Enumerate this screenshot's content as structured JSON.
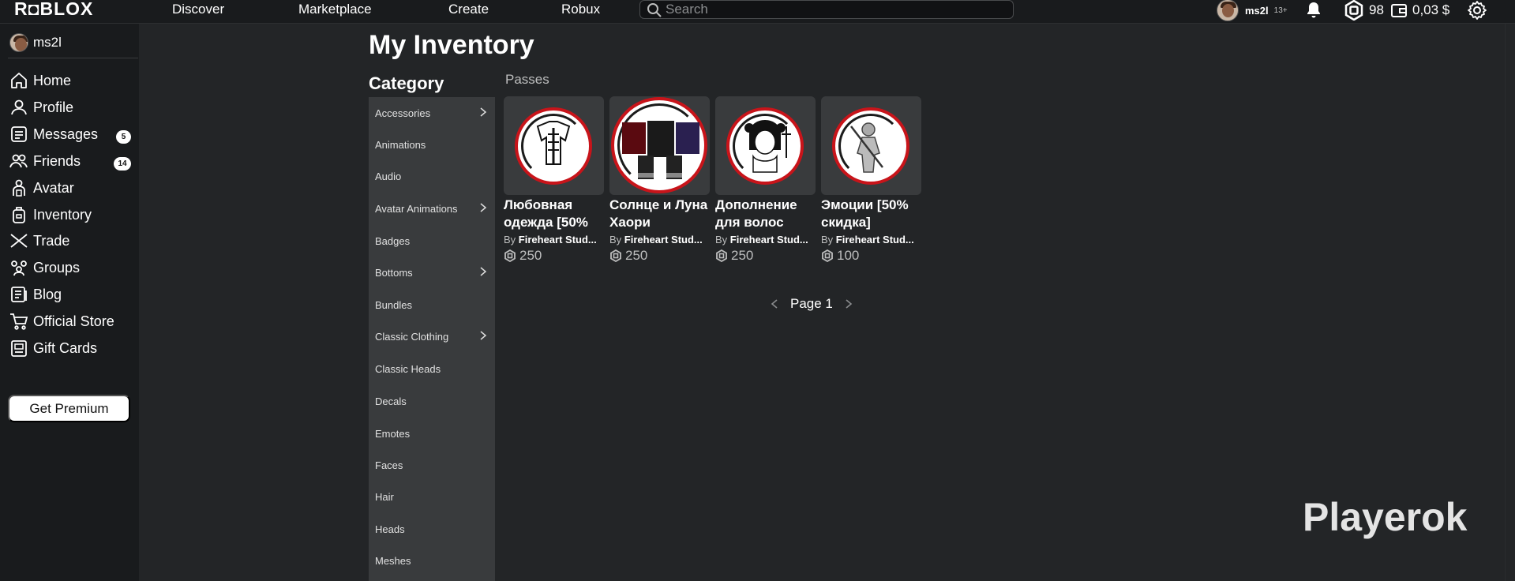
{
  "topbar": {
    "logo": "R◘BLOX",
    "nav": [
      "Discover",
      "Marketplace",
      "Create",
      "Robux"
    ],
    "search_placeholder": "Search",
    "username": "ms2l",
    "age_badge": "13+",
    "robux_count": "98",
    "balance": "0,03 $"
  },
  "sidebar": {
    "username": "ms2l",
    "items": [
      {
        "label": "Home",
        "icon": "home-icon"
      },
      {
        "label": "Profile",
        "icon": "profile-icon"
      },
      {
        "label": "Messages",
        "icon": "messages-icon",
        "badge": "5"
      },
      {
        "label": "Friends",
        "icon": "friends-icon",
        "badge": "14"
      },
      {
        "label": "Avatar",
        "icon": "avatar-icon"
      },
      {
        "label": "Inventory",
        "icon": "inventory-icon"
      },
      {
        "label": "Trade",
        "icon": "trade-icon"
      },
      {
        "label": "Groups",
        "icon": "groups-icon"
      },
      {
        "label": "Blog",
        "icon": "blog-icon"
      },
      {
        "label": "Official Store",
        "icon": "store-icon"
      },
      {
        "label": "Gift Cards",
        "icon": "gift-cards-icon"
      }
    ],
    "premium_label": "Get Premium"
  },
  "main": {
    "title": "My Inventory",
    "category_title": "Category",
    "section_label": "Passes",
    "categories": [
      {
        "label": "Accessories",
        "has_sub": true
      },
      {
        "label": "Animations",
        "has_sub": false
      },
      {
        "label": "Audio",
        "has_sub": false
      },
      {
        "label": "Avatar Animations",
        "has_sub": true
      },
      {
        "label": "Badges",
        "has_sub": false
      },
      {
        "label": "Bottoms",
        "has_sub": true
      },
      {
        "label": "Bundles",
        "has_sub": false
      },
      {
        "label": "Classic Clothing",
        "has_sub": true
      },
      {
        "label": "Classic Heads",
        "has_sub": false
      },
      {
        "label": "Decals",
        "has_sub": false
      },
      {
        "label": "Emotes",
        "has_sub": false
      },
      {
        "label": "Faces",
        "has_sub": false
      },
      {
        "label": "Hair",
        "has_sub": false
      },
      {
        "label": "Heads",
        "has_sub": false
      },
      {
        "label": "Meshes",
        "has_sub": false
      }
    ],
    "items": [
      {
        "name": "Любовная одежда [50%",
        "by_prefix": "By",
        "creator": "Fireheart Stud...",
        "price": "250"
      },
      {
        "name": "Солнце и Луна Хаори",
        "by_prefix": "By",
        "creator": "Fireheart Stud...",
        "price": "250"
      },
      {
        "name": "Дополнение для волос",
        "by_prefix": "By",
        "creator": "Fireheart Stud...",
        "price": "250"
      },
      {
        "name": "Эмоции [50% скидка]",
        "by_prefix": "By",
        "creator": "Fireheart Stud...",
        "price": "100"
      }
    ],
    "pager_label": "Page 1"
  },
  "watermark": "Playerok",
  "colors": {
    "bg": "#232527",
    "sidebar": "#191b1d",
    "panel": "#393b3d",
    "accent_red": "#c8141a"
  }
}
